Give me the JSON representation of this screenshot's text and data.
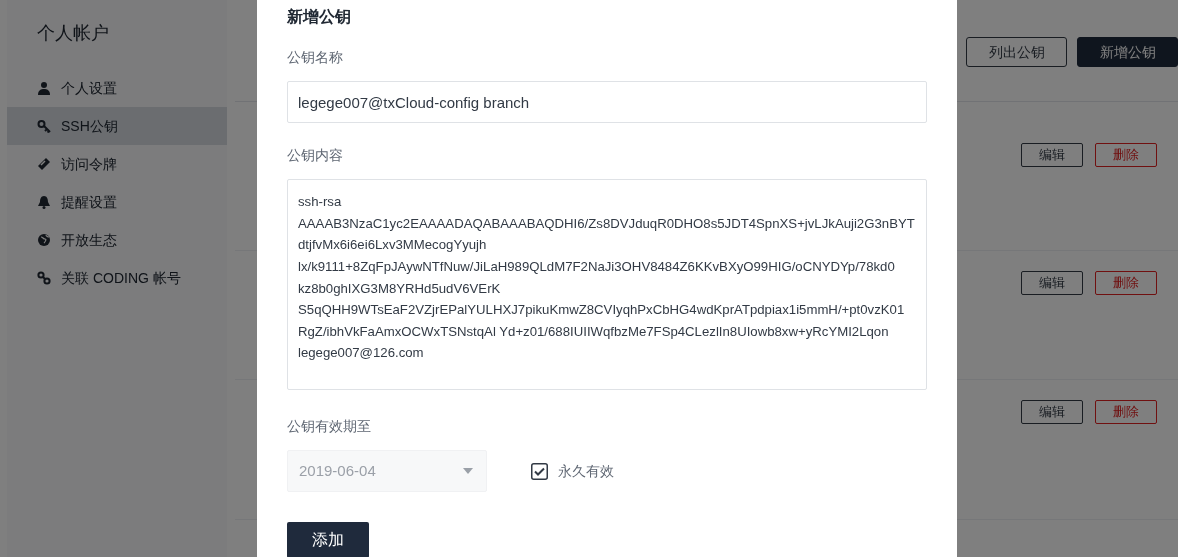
{
  "sidebar": {
    "title": "个人帐户",
    "items": [
      {
        "label": "个人设置",
        "kind": "user",
        "selected": false
      },
      {
        "label": "SSH公钥",
        "kind": "key",
        "selected": true
      },
      {
        "label": "访问令牌",
        "kind": "ticket",
        "selected": false
      },
      {
        "label": "提醒设置",
        "kind": "bell",
        "selected": false
      },
      {
        "label": "开放生态",
        "kind": "globe",
        "selected": false
      },
      {
        "label": "关联 CODING 帐号",
        "kind": "link",
        "selected": false
      }
    ]
  },
  "header_buttons": [
    {
      "label": "列出公钥",
      "kind": "outline"
    },
    {
      "label": "新增公钥",
      "kind": "dark"
    }
  ],
  "key_rows": [
    {
      "edit": "编辑",
      "delete": "删除"
    },
    {
      "edit": "编辑",
      "delete": "删除"
    },
    {
      "edit": "编辑",
      "delete": "删除"
    }
  ],
  "modal": {
    "title": "新增公钥",
    "name_label": "公钥名称",
    "name_value": "legege007@txCloud-config branch",
    "content_label": "公钥内容",
    "content_lines": [
      "ssh-rsa",
      "AAAAB3NzaC1yc2EAAAADAQABAAABAQDHI6/Zs8DVJduqR0DHO8s5JDT4SpnXS+jvLJkAuji2G3nBYT",
      "dtjfvMx6i6ei6Lxv3MMecogYyujh",
      "lx/k9111+8ZqFpJAywNTfNuw/JiLaH989QLdM7F2NaJi3OHV8484Z6KKvBXyO99HIG/oCNYDYp/78kd0",
      "kz8b0ghIXG3M8YRHd5udV6VErK",
      "S5qQHH9WTsEaF2VZjrEPalYULHXJ7pikuKmwZ8CVIyqhPxCbHG4wdKprATpdpiax1i5mmH/+pt0vzK01",
      "RgZ/ibhVkFaAmxOCWxTSNstqAl Yd+z01/688IUIIWqfbzMe7FSp4CLezlIn8UIowb8xw+yRcYMI2Lqon",
      "legege007@126.com"
    ],
    "expiry_label": "公钥有效期至",
    "expiry_value": "2019-06-04",
    "expiry_disabled": true,
    "permanent_label": "永久有效",
    "permanent_checked": true,
    "submit": "添加"
  }
}
